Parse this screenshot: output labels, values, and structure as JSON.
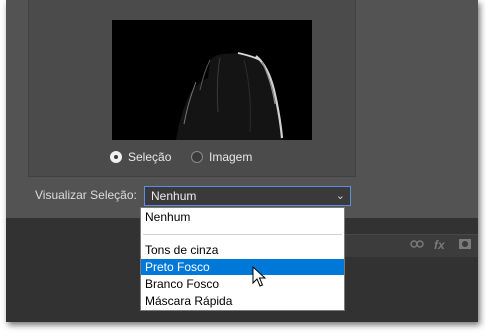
{
  "preview": {
    "options": [
      {
        "label": "Seleção",
        "selected": true
      },
      {
        "label": "Imagem",
        "selected": false
      }
    ]
  },
  "visualizar": {
    "label": "Visualizar Seleção:",
    "value": "Nenhum",
    "options": [
      "Nenhum",
      "Tons de cinza",
      "Preto Fosco",
      "Branco Fosco",
      "Máscara Rápida"
    ],
    "highlighted": "Preto Fosco"
  },
  "toolbar": {
    "icons": [
      "link-icon",
      "fx-icon",
      "mask-icon"
    ],
    "fx_label": "fx"
  },
  "colors": {
    "dialog_bg": "#535353",
    "highlight": "#0078d7",
    "focus_border": "#5a8ee0"
  }
}
